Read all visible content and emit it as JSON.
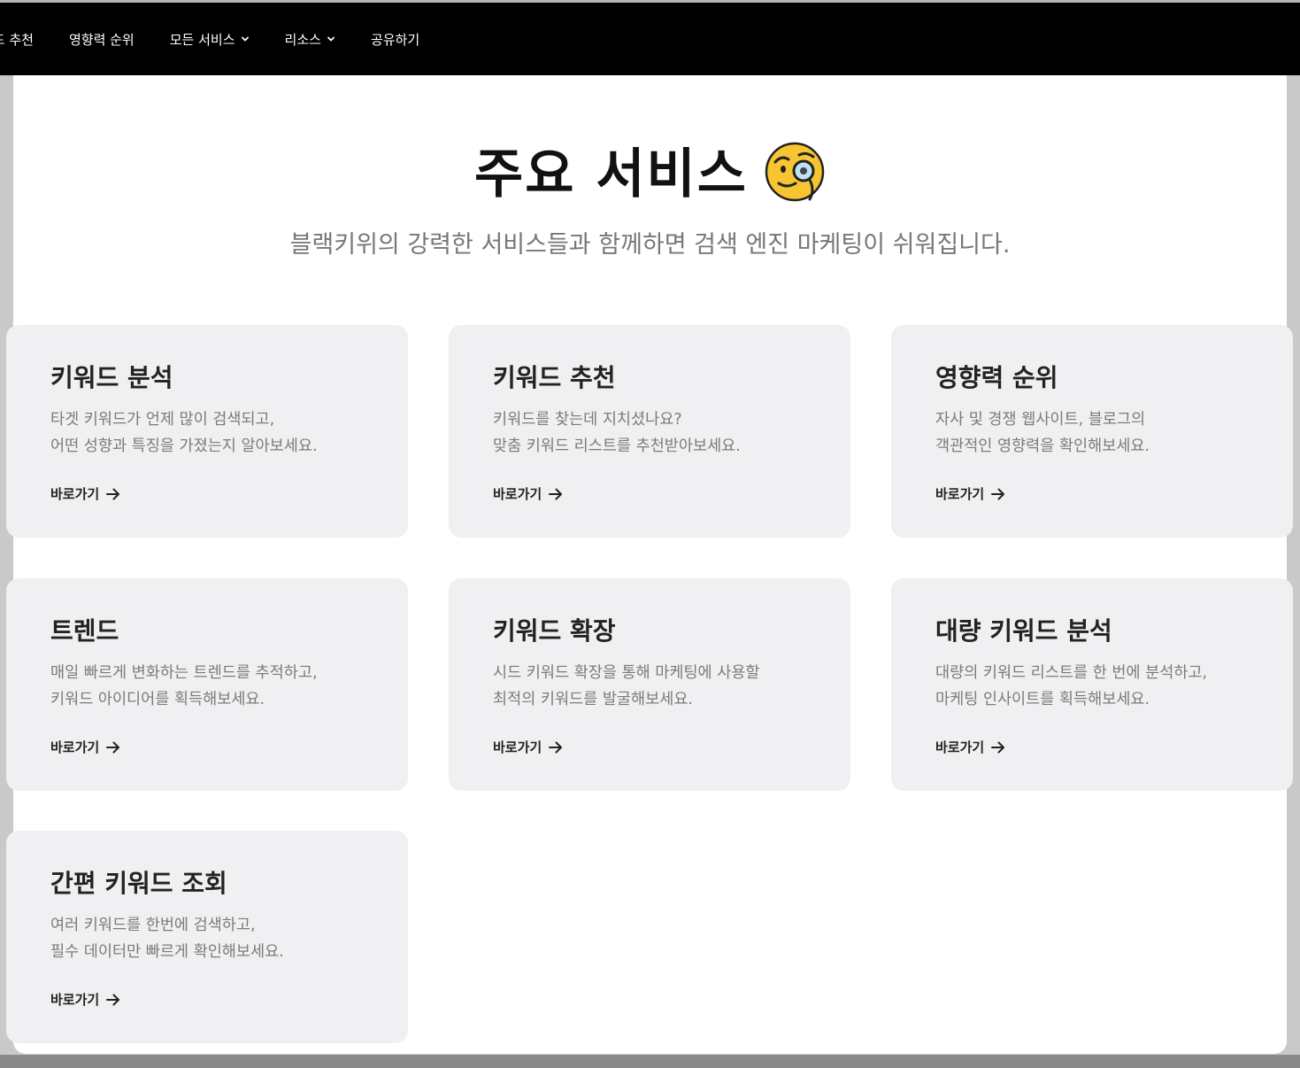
{
  "nav": {
    "items": [
      {
        "label": "워드 추천",
        "has_dropdown": false
      },
      {
        "label": "영향력 순위",
        "has_dropdown": false
      },
      {
        "label": "모든 서비스",
        "has_dropdown": true
      },
      {
        "label": "리소스",
        "has_dropdown": true
      },
      {
        "label": "공유하기",
        "has_dropdown": false
      }
    ]
  },
  "hero": {
    "title": "주요 서비스",
    "emoji_icon": "face-with-monocle-icon",
    "subtitle": "블랙키위의 강력한 서비스들과 함께하면 검색 엔진 마케팅이 쉬워집니다."
  },
  "cards": [
    {
      "title": "키워드 분석",
      "desc": "타겟 키워드가 언제 많이 검색되고,\n어떤 성향과 특징을 가졌는지 알아보세요.",
      "link": "바로가기"
    },
    {
      "title": "키워드 추천",
      "desc": "키워드를 찾는데 지치셨나요?\n맞춤 키워드 리스트를 추천받아보세요.",
      "link": "바로가기"
    },
    {
      "title": "영향력 순위",
      "desc": "자사 및 경쟁 웹사이트, 블로그의\n객관적인 영향력을 확인해보세요.",
      "link": "바로가기"
    },
    {
      "title": "트렌드",
      "desc": "매일 빠르게 변화하는 트렌드를 추적하고,\n키워드 아이디어를 획득해보세요.",
      "link": "바로가기"
    },
    {
      "title": "키워드 확장",
      "desc": "시드 키워드 확장을 통해 마케팅에 사용할\n최적의 키워드를 발굴해보세요.",
      "link": "바로가기"
    },
    {
      "title": "대량 키워드 분석",
      "desc": "대량의 키워드 리스트를 한 번에 분석하고,\n마케팅 인사이트를 획득해보세요.",
      "link": "바로가기"
    },
    {
      "title": "간편 키워드 조회",
      "desc": "여러 키워드를 한번에 검색하고,\n필수 데이터만 빠르게 확인해보세요.",
      "link": "바로가기"
    }
  ],
  "colors": {
    "topbar": "#000000",
    "card_bg": "#f0f0f2",
    "title_text": "#222222",
    "desc_text": "#7b7b7b"
  }
}
